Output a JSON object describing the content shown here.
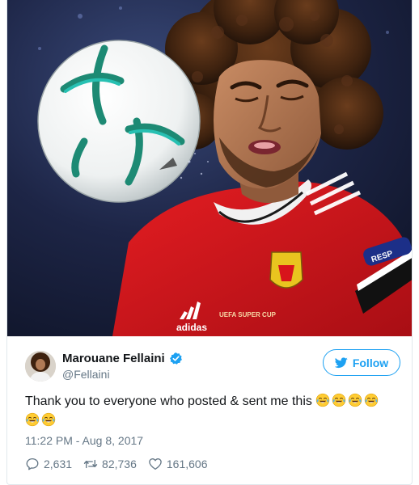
{
  "tweet": {
    "author": {
      "display_name": "Marouane Fellaini",
      "handle": "@Fellaini",
      "verified": true
    },
    "follow_button": {
      "icon": "twitter-bird-icon",
      "label": "Follow"
    },
    "text": "Thank you to everyone who posted & sent me this",
    "emoji": {
      "name": "face-with-tears-of-joy",
      "line1_count": 4,
      "line2_count": 2
    },
    "timestamp": "11:22 PM - Aug 8, 2017",
    "actions": {
      "replies": {
        "icon": "reply-icon",
        "count": "2,631"
      },
      "retweets": {
        "icon": "retweet-icon",
        "count": "82,736"
      },
      "likes": {
        "icon": "heart-icon",
        "count": "161,606"
      }
    },
    "media": {
      "jersey_text": [
        "adidas",
        "UEFA SUPER CUP",
        "RESP"
      ]
    }
  },
  "colors": {
    "twitter_blue": "#1da1f2",
    "secondary_text": "#657786",
    "jersey_red": "#d8141b",
    "stadium_blue": "#1b2240"
  }
}
